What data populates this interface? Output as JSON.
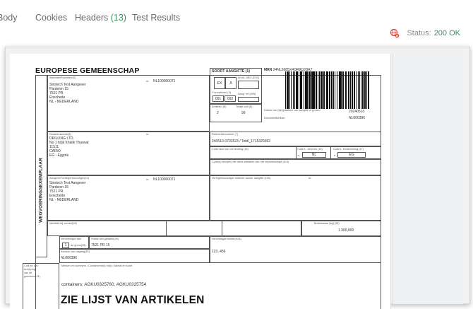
{
  "tabs": [
    {
      "label": "Body"
    },
    {
      "label": "Cookies"
    },
    {
      "label": "Headers",
      "count": "(13)"
    },
    {
      "label": "Test Results"
    }
  ],
  "status": {
    "label": "Status:",
    "value": "200 OK"
  },
  "document": {
    "title": "EUROPESE GEMEENSCHAP",
    "vertical_label": "WEGVOERINGSEXEMPLAAR",
    "exporter": {
      "label": "Afzender/Exporteur(2)",
      "nr_label": "nr.",
      "nr": "NL100000071",
      "lines": [
        "Strotech Test Aangever",
        "Pardeion 15",
        "7521 PR",
        "Enschede",
        "NL - NEDERLAND"
      ]
    },
    "declaration_type": {
      "label": "SOORT AANGIFTE (1)",
      "a": "EX",
      "b": "A"
    },
    "ksd": {
      "label": "Arctic. ABO (D32)"
    },
    "mrn": {
      "label": "MRN",
      "value": "24NL5685X4OR9QJDA7"
    },
    "forms": {
      "label": "Formulieren (3)",
      "a": "001",
      "b": "002"
    },
    "ref_count": {
      "label": "Aang. ref (005)"
    },
    "items": {
      "label": "Artikelen (5)",
      "value": "2"
    },
    "packages": {
      "label": "Totaal colli (6)",
      "value": "99"
    },
    "acceptance": {
      "label": "Datum van (tijd)plaatsen van aangifte of grosko",
      "date": "20240510"
    },
    "document_nr": {
      "label": "Documentkenkan",
      "value": "NL000396"
    },
    "consignee": {
      "label": "Geadresseerde(8)",
      "nr_label": "nr.",
      "lines": [
        "DRILLING LTD.",
        "No 1 tidal Khalik Tharwat",
        "11511",
        "CAIRO",
        "EG - Egypte"
      ]
    },
    "reference": {
      "label": "Referentienummer (7)",
      "value": "240510-0702523 / Totdl_1715329392"
    },
    "dispatch_country": {
      "label": "Code land van verzending (15)"
    },
    "country_code_a": {
      "label": "Code L. verzndn (15)",
      "prefix": "a",
      "value": "NL"
    },
    "country_code_b": {
      "label": "Code L. bestemming (17)",
      "prefix": "a",
      "value": "EG"
    },
    "destination_label": "Code(s) land(en) die dient uitmaken van het verzoekschapt (513)",
    "declarant": {
      "label": "Aangever/Vertegenwoordiger(14)",
      "nr_label": "nr.",
      "nr": "NL100000071",
      "lines": [
        "Strotech Test Aangever",
        "Pardeion 15",
        "7521 PR",
        "Enschede",
        "NL - NEDERLAND"
      ]
    },
    "rep_note": {
      "label": "Vertegenwoordiger indiener aanstr. aangifte (14b)",
      "nr_label": "nr."
    },
    "id_label": "Identiteit bij vertrek(18)",
    "gross_mass": {
      "label": "Brutomassa (kg) (35)",
      "value": "1.300,000"
    },
    "transport_mode": {
      "label": "Vervoerwijze aan",
      "value": "1",
      "border_label": "de grens(25)"
    },
    "exit_place": {
      "label": "Plaats van geladen(30)",
      "value": "7521 PR 15"
    },
    "exit_office": {
      "label": "Kantoor van uitgang(29)",
      "value": "NL000396"
    },
    "transport_doc": {
      "label": "Vervoerdgerummer(S28)",
      "value": "123, 456"
    },
    "goods_side_label": [
      "Colli en om-",
      "schrijving",
      "van de",
      "goederen(31)"
    ],
    "goods_header": "Merken en nummers • Containernr(s) nr(s) • Aantal en soort",
    "containers": "containers: AGKU0325760, AGKU0325754",
    "big_text": "ZIE LIJST VAN ARTIKELEN"
  }
}
